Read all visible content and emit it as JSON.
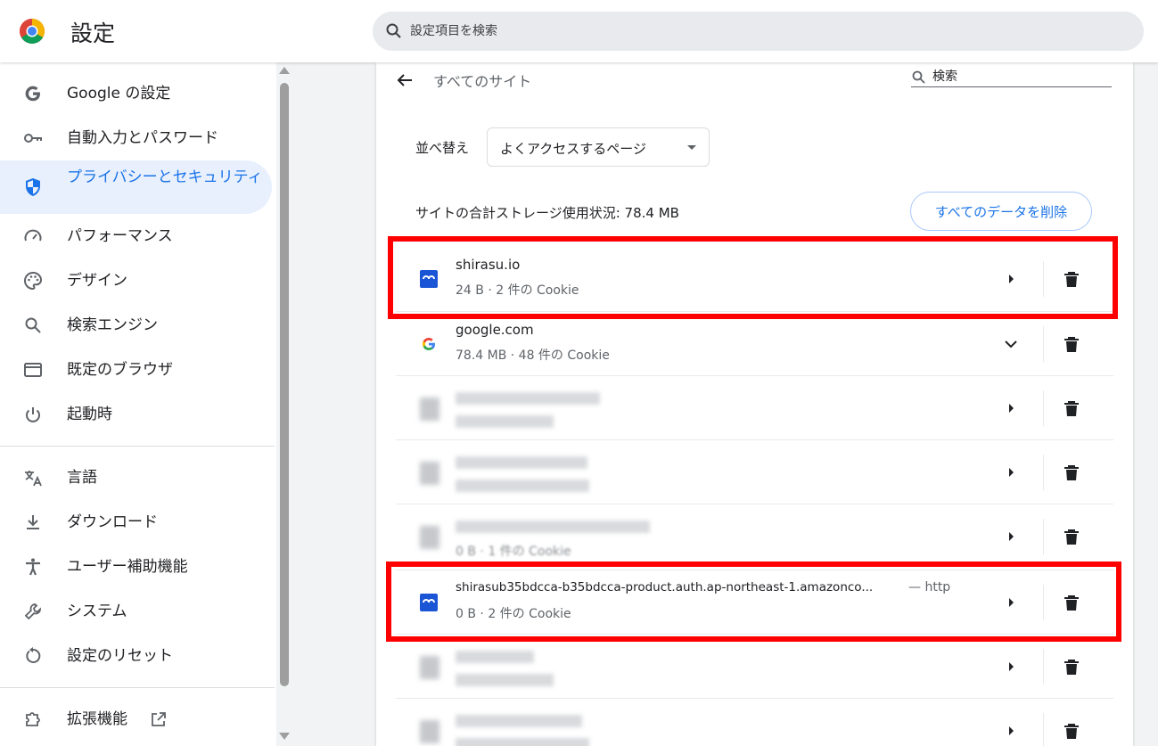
{
  "header": {
    "title": "設定",
    "search_placeholder": "設定項目を検索"
  },
  "sidebar": {
    "items": [
      {
        "label": "Google の設定",
        "icon": "google-g-icon"
      },
      {
        "label": "自動入力とパスワード",
        "icon": "key-icon"
      },
      {
        "label": "プライバシーとセキュリティ",
        "icon": "shield-icon",
        "active": true
      },
      {
        "label": "パフォーマンス",
        "icon": "speedometer-icon"
      },
      {
        "label": "デザイン",
        "icon": "palette-icon"
      },
      {
        "label": "検索エンジン",
        "icon": "search-icon"
      },
      {
        "label": "既定のブラウザ",
        "icon": "browser-window-icon"
      },
      {
        "label": "起動時",
        "icon": "power-icon"
      },
      {
        "label": "言語",
        "icon": "translate-icon"
      },
      {
        "label": "ダウンロード",
        "icon": "download-icon"
      },
      {
        "label": "ユーザー補助機能",
        "icon": "accessibility-icon"
      },
      {
        "label": "システム",
        "icon": "wrench-icon"
      },
      {
        "label": "設定のリセット",
        "icon": "reset-icon"
      },
      {
        "label": "拡張機能",
        "icon": "puzzle-icon"
      }
    ]
  },
  "main": {
    "title": "すべてのサイト",
    "search_placeholder": "検索",
    "sort_label": "並べ替え",
    "sort_value": "よくアクセスするページ",
    "storage_text": "サイトの合計ストレージ使用状況: 78.4 MB",
    "clear_all_label": "すべてのデータを削除",
    "sites": [
      {
        "host": "shirasu.io",
        "detail": "24 B · 2 件の Cookie",
        "favicon": "shirasu-icon",
        "expanded": false,
        "highlighted": true
      },
      {
        "host": "google.com",
        "detail": "78.4 MB · 48 件の Cookie",
        "favicon": "google-g-icon",
        "expanded": true
      },
      {
        "host": "",
        "detail": "",
        "obscured": true
      },
      {
        "host": "",
        "detail": "",
        "obscured": true
      },
      {
        "host": "",
        "detail": "0 B · 1 件の Cookie",
        "obscured": true
      },
      {
        "host": "shirasub35bdcca-b35bdcca-product.auth.ap-northeast-1.amazonco...",
        "scheme": "— http",
        "detail": "0 B · 2 件の Cookie",
        "favicon": "shirasu-icon",
        "expanded": false,
        "highlighted": true
      },
      {
        "host": "",
        "detail": "",
        "obscured": true
      },
      {
        "host": "",
        "detail": "",
        "obscured": true
      }
    ]
  },
  "colors": {
    "accent": "#1a73e8",
    "highlight": "#ff0000",
    "active_bg": "#e8f0fe"
  }
}
